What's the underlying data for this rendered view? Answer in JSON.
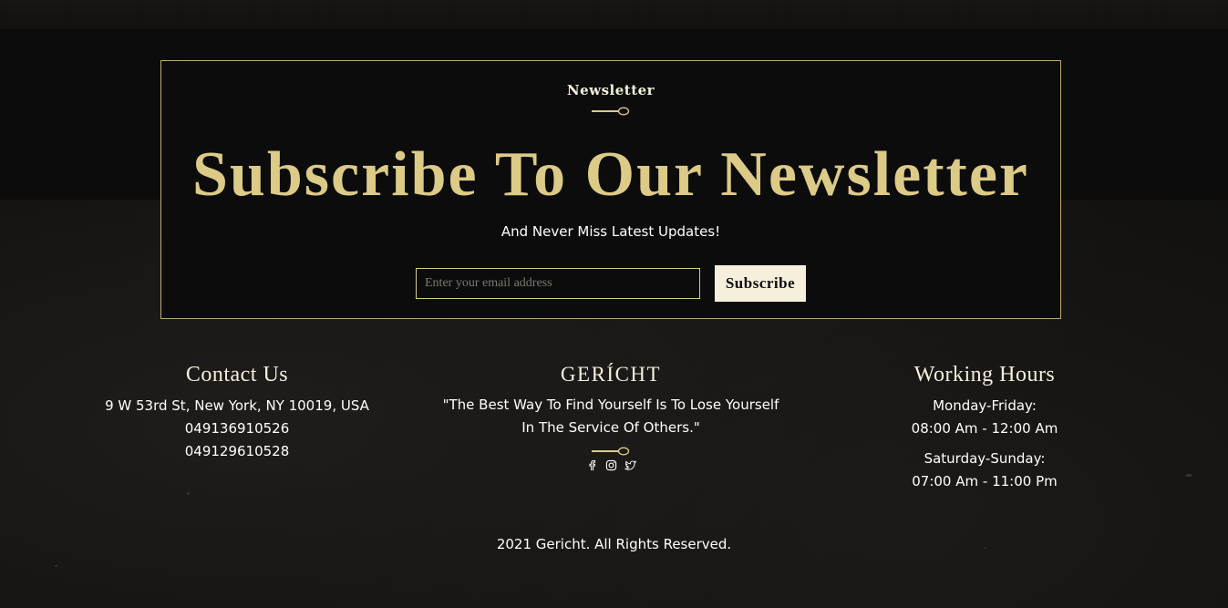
{
  "newsletter": {
    "eyebrow": "Newsletter",
    "heading": "Subscribe To Our Newsletter",
    "subheading": "And Never Miss Latest Updates!",
    "email_placeholder": "Enter your email address",
    "subscribe_label": "Subscribe"
  },
  "contact": {
    "title": "Contact Us",
    "address": "9 W 53rd St, New York, NY 10019, USA",
    "phone_1": "049136910526",
    "phone_2": "049129610528"
  },
  "brand": {
    "logo": "GERÍCHT",
    "quote_line_1": "\"The Best Way To Find Yourself Is To Lose Yourself",
    "quote_line_2": "In The Service Of Others.\"",
    "socials": [
      "facebook-icon",
      "instagram-icon",
      "twitter-icon"
    ]
  },
  "hours": {
    "title": "Working Hours",
    "weekday_label": "Monday-Friday:",
    "weekday_time": "08:00 Am - 12:00 Am",
    "weekend_label": "Saturday-Sunday:",
    "weekend_time": "07:00 Am - 11:00 Pm"
  },
  "footer": {
    "copyright": "2021 Gericht. All Rights Reserved."
  },
  "colors": {
    "gold": "#dcca87",
    "crimson": "#f5efdb",
    "black": "#0c0c0c"
  }
}
